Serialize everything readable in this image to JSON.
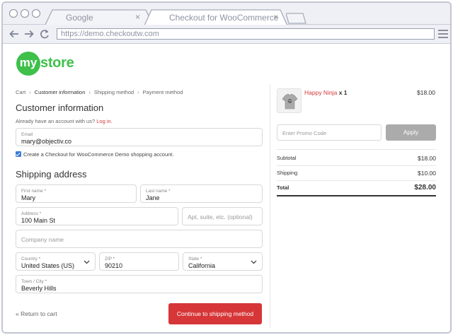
{
  "browser": {
    "tabs": [
      {
        "title": "Google",
        "close": "×",
        "active": false
      },
      {
        "title": "Checkout for WooCommerce",
        "close": "×",
        "active": true
      }
    ],
    "url": "https://demo.checkoutw.com"
  },
  "store": {
    "logo_circle": "my",
    "logo_text": "store",
    "brand_color": "#3ec04b"
  },
  "breadcrumb": [
    "Cart",
    "Customer information",
    "Shipping method",
    "Payment method"
  ],
  "breadcrumb_sep": "›",
  "customer": {
    "heading": "Customer information",
    "have_account": "Already have an account with us?",
    "login_link": "Log in.",
    "email_label": "Email",
    "email_value": "mary@objectiv.co",
    "create_account_label": "Create a Checkout for WooCommerce Demo shopping account."
  },
  "shipping": {
    "heading": "Shipping address",
    "first_name": {
      "label": "First name *",
      "value": "Mary"
    },
    "last_name": {
      "label": "Last name *",
      "value": "Jane"
    },
    "address": {
      "label": "Address *",
      "value": "100 Main St"
    },
    "apt_placeholder": "Apt, suite, etc. (optional)",
    "company_placeholder": "Company name",
    "country": {
      "label": "Country *",
      "value": "United States (US)"
    },
    "zip": {
      "label": "ZIP *",
      "value": "90210"
    },
    "state": {
      "label": "State *",
      "value": "California"
    },
    "city": {
      "label": "Town / City *",
      "value": "Beverly Hills"
    }
  },
  "actions": {
    "return_link": "« Return to cart",
    "continue_button": "Continue to shipping method",
    "button_color": "#d63638"
  },
  "summary": {
    "product_name": "Happy Ninja",
    "product_qty": "x 1",
    "product_price": "$18.00",
    "promo_placeholder": "Enter Promo Code",
    "apply_label": "Apply",
    "subtotal_label": "Subtotal",
    "subtotal_value": "$18.00",
    "shipping_label": "Shipping",
    "shipping_value": "$10.00",
    "total_label": "Total",
    "total_value": "$28.00"
  }
}
